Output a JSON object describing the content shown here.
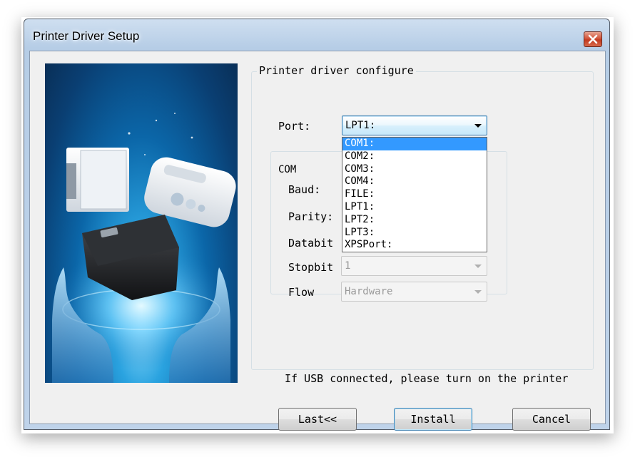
{
  "window": {
    "title": "Printer Driver Setup",
    "close_icon": "close-x-icon",
    "hero_image": "printers-held-in-hands-illustration"
  },
  "main_group": {
    "title": "Printer driver configure",
    "port_label": "Port:",
    "port_selected": "LPT1:",
    "port_options": [
      "COM1:",
      "COM2:",
      "COM3:",
      "COM4:",
      "FILE:",
      "LPT1:",
      "LPT2:",
      "LPT3:",
      "XPSPort:"
    ],
    "highlighted_option": "COM1:"
  },
  "com_group": {
    "title": "COM",
    "baud_label": "Baud:",
    "parity_label": "Parity:",
    "databit_label": "Databit",
    "stopbit_label": "Stopbit",
    "stopbit_value": "1",
    "flow_label": "Flow",
    "flow_value": "Hardware"
  },
  "usb_message": "If USB connected, please turn on the printer",
  "buttons": {
    "last": "Last<<",
    "install": "Install",
    "cancel": "Cancel"
  },
  "colors": {
    "selection": "#3399ff",
    "focus_border": "#3c7fb1",
    "close_button": "#c23a20"
  }
}
